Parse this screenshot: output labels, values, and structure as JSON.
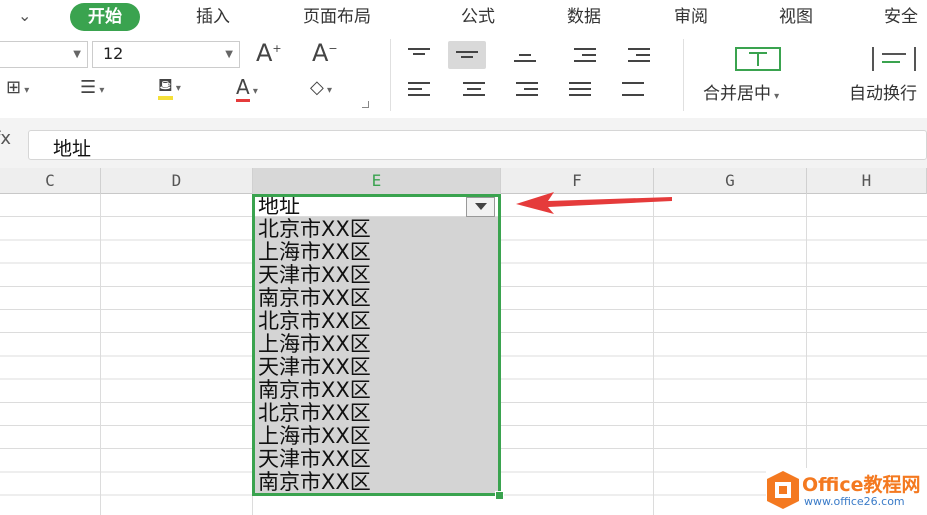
{
  "tabs": {
    "items": [
      "开始",
      "插入",
      "页面布局",
      "公式",
      "数据",
      "审阅",
      "视图",
      "安全"
    ],
    "active": "开始"
  },
  "toolbar": {
    "font_size": "12",
    "increase_font_label": "A",
    "decrease_font_label": "A",
    "merge_center_label": "合并居中",
    "wrap_text_label": "自动换行"
  },
  "formula_bar": {
    "fx_label": "fx",
    "content": "地址"
  },
  "columns": [
    "C",
    "D",
    "E",
    "F",
    "G",
    "H"
  ],
  "selected_column": "E",
  "column_e": {
    "header_cell": "地址",
    "values": [
      "北京市XX区",
      "上海市XX区",
      "天津市XX区",
      "南京市XX区",
      "北京市XX区",
      "上海市XX区",
      "天津市XX区",
      "南京市XX区",
      "北京市XX区",
      "上海市XX区",
      "天津市XX区",
      "南京市XX区"
    ]
  },
  "watermark": {
    "title": "Office教程网",
    "url": "www.office26.com"
  },
  "colors": {
    "accent": "#3aa34f",
    "arrow": "#e53b3b",
    "watermark_orange": "#f47920"
  }
}
